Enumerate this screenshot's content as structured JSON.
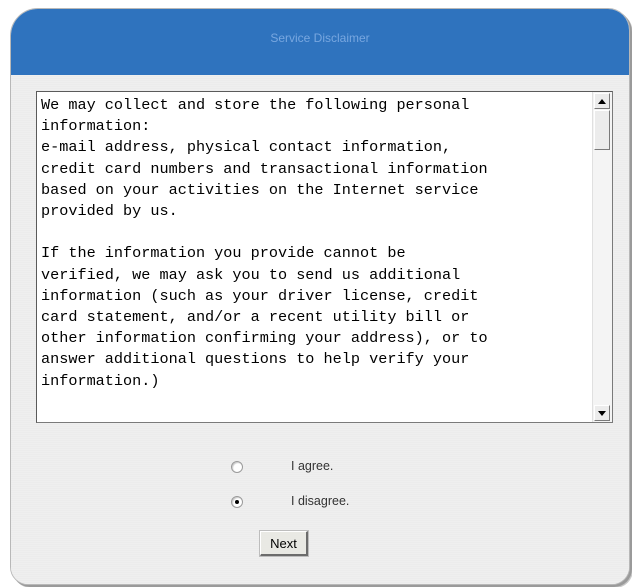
{
  "header": {
    "title": "Service Disclaimer"
  },
  "disclaimer": {
    "text": "We may collect and store the following personal\ninformation:\ne-mail address, physical contact information,\ncredit card numbers and transactional information\nbased on your activities on the Internet service\nprovided by us.\n\nIf the information you provide cannot be\nverified, we may ask you to send us additional\ninformation (such as your driver license, credit\ncard statement, and/or a recent utility bill or\nother information confirming your address), or to\nanswer additional questions to help verify your\ninformation.)"
  },
  "options": [
    {
      "label": "I agree.",
      "checked": false
    },
    {
      "label": "I disagree.",
      "checked": true
    }
  ],
  "buttons": {
    "next_label": "Next"
  },
  "scrollbar": {
    "up_icon": "arrow-up-icon",
    "down_icon": "arrow-down-icon"
  }
}
